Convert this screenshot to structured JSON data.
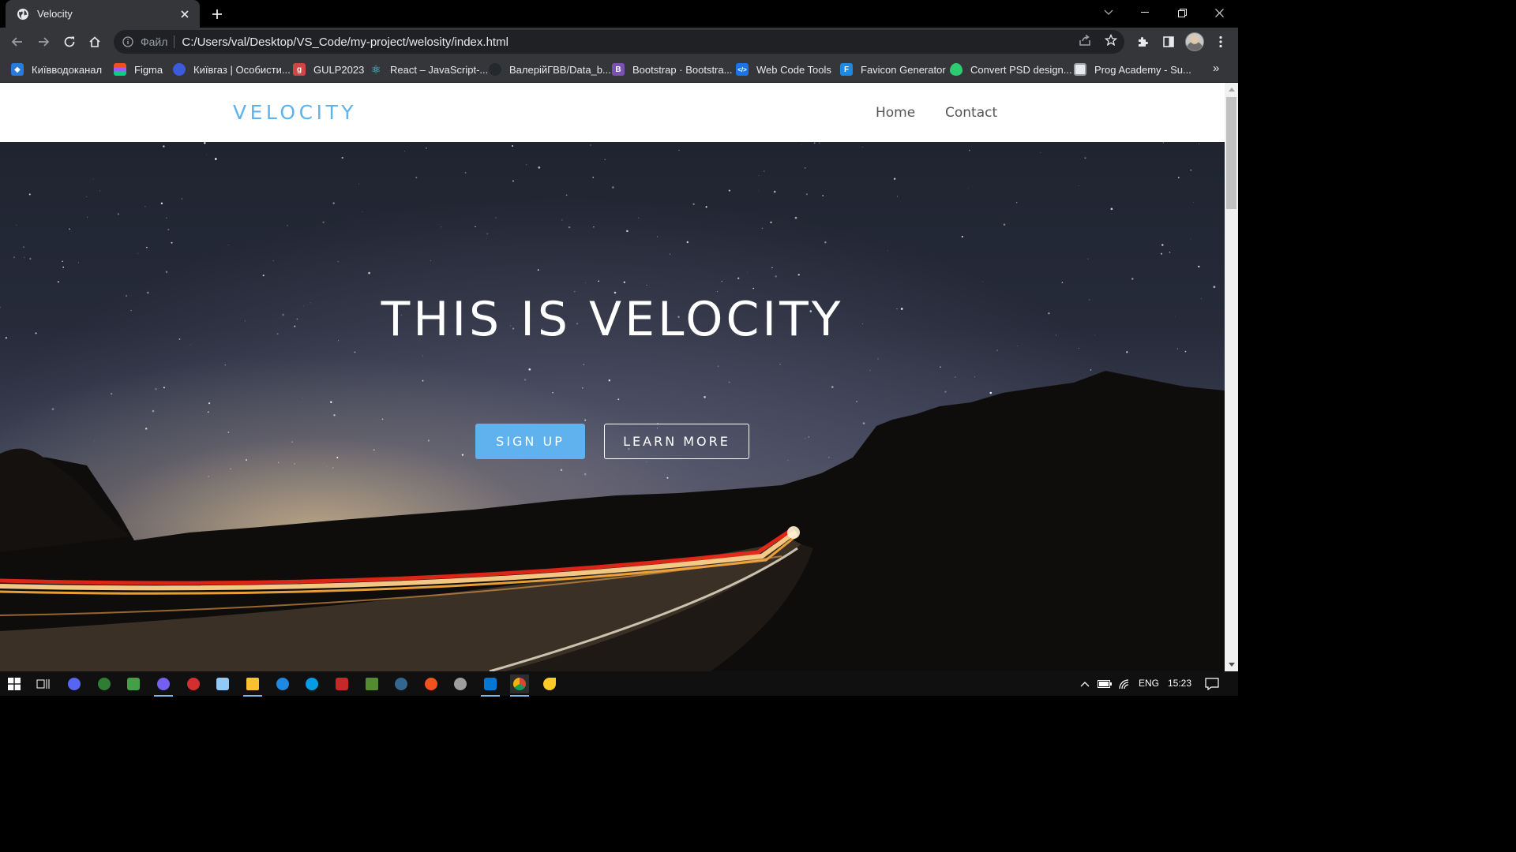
{
  "browser": {
    "tab_title": "Velocity",
    "address_scheme": "Файл",
    "address_url": "C:/Users/val/Desktop/VS_Code/my-project/welosity/index.html"
  },
  "bookmarks": [
    {
      "label": "Київводоканал",
      "icon": "kyivvodokanal-icon",
      "color": "#2a7bd9"
    },
    {
      "label": "Figma",
      "icon": "figma-icon",
      "color": "#f24e1e"
    },
    {
      "label": "Київгаз | Особисти...",
      "icon": "kyivgaz-icon",
      "color": "#3b5bdb"
    },
    {
      "label": "GULP2023",
      "icon": "gulp-icon",
      "color": "#cf4647"
    },
    {
      "label": "React – JavaScript-...",
      "icon": "react-icon",
      "color": "#61dafb"
    },
    {
      "label": "ВалерійГВВ/Data_b...",
      "icon": "github-icon",
      "color": "#24292e"
    },
    {
      "label": "Bootstrap · Bootstra...",
      "icon": "bootstrap-icon",
      "color": "#7952b3"
    },
    {
      "label": "Web Code Tools",
      "icon": "webcodetools-icon",
      "color": "#1a73e8"
    },
    {
      "label": "Favicon Generator",
      "icon": "favicon-generator-icon",
      "color": "#1e88e5"
    },
    {
      "label": "Convert PSD design...",
      "icon": "convert-psd-icon",
      "color": "#2ecc71"
    },
    {
      "label": "Prog Academy  - Su...",
      "icon": "prog-academy-icon",
      "color": "#e8eaed"
    }
  ],
  "site": {
    "logo": "VELOCITY",
    "nav": [
      "Home",
      "Contact"
    ],
    "hero_title": "THIS IS VELOCITY",
    "signup_label": "SIGN UP",
    "learn_more_label": "LEARN MORE",
    "accent_color": "#5fb2ee"
  },
  "taskbar": {
    "apps": [
      "windows-start-icon",
      "task-view-icon",
      "discord-icon",
      "app-icon",
      "app-icon",
      "viber-icon",
      "app-icon",
      "app-icon",
      "file-explorer-icon",
      "app-icon",
      "app-icon",
      "app-icon",
      "app-icon",
      "app-icon",
      "app-icon",
      "app-icon",
      "vscode-icon",
      "chrome-icon",
      "app-icon"
    ],
    "language": "ENG",
    "time": "15:23"
  }
}
